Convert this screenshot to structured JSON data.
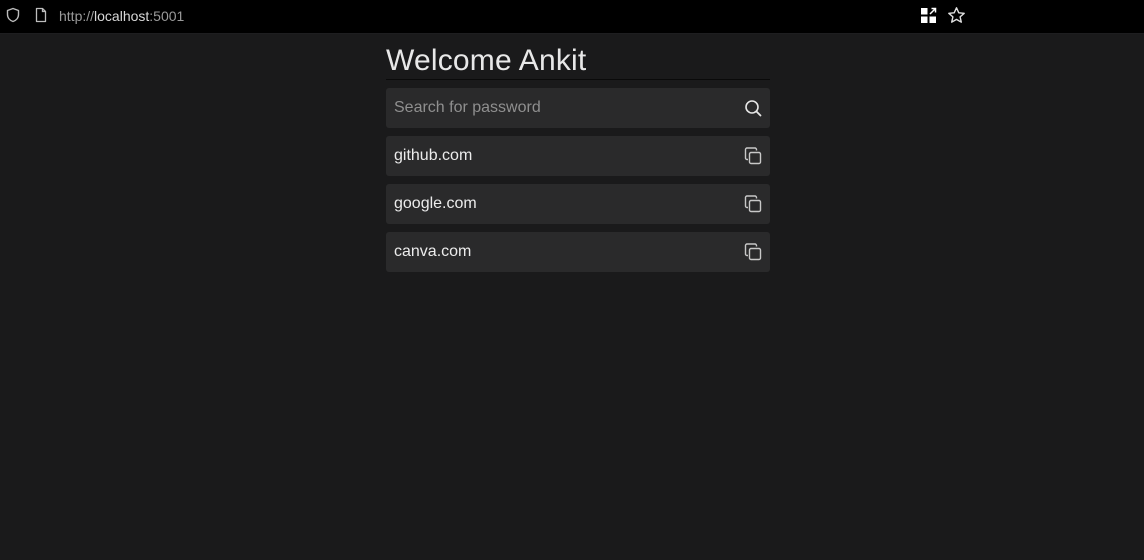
{
  "browser": {
    "url_scheme": "http://",
    "url_host": "localhost",
    "url_port": ":5001",
    "icons": [
      "shield-icon",
      "page-icon",
      "extensions-icon",
      "star-icon"
    ]
  },
  "main": {
    "title": "Welcome Ankit",
    "search": {
      "placeholder": "Search for password",
      "value": "",
      "icon": "search-icon"
    },
    "items": [
      {
        "label": "github.com",
        "icon": "copy-icon"
      },
      {
        "label": "google.com",
        "icon": "copy-icon"
      },
      {
        "label": "canva.com",
        "icon": "copy-icon"
      }
    ]
  },
  "colors": {
    "background": "#1a1a1b",
    "card": "#2a2a2b",
    "toolbar": "#000000"
  }
}
